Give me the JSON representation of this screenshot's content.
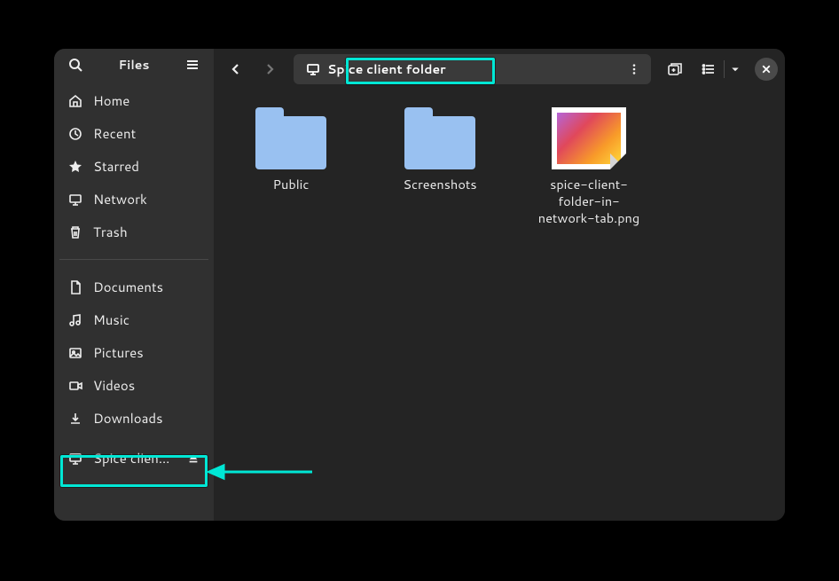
{
  "app_title": "Files",
  "sidebar": {
    "places": [
      {
        "id": "home",
        "label": "Home",
        "icon": "home"
      },
      {
        "id": "recent",
        "label": "Recent",
        "icon": "clock"
      },
      {
        "id": "starred",
        "label": "Starred",
        "icon": "star"
      },
      {
        "id": "network",
        "label": "Network",
        "icon": "network"
      },
      {
        "id": "trash",
        "label": "Trash",
        "icon": "trash"
      }
    ],
    "xdg": [
      {
        "id": "documents",
        "label": "Documents",
        "icon": "document"
      },
      {
        "id": "music",
        "label": "Music",
        "icon": "music"
      },
      {
        "id": "pictures",
        "label": "Pictures",
        "icon": "picture"
      },
      {
        "id": "videos",
        "label": "Videos",
        "icon": "video"
      },
      {
        "id": "downloads",
        "label": "Downloads",
        "icon": "download"
      }
    ],
    "mount": {
      "label": "Spice clien…",
      "full_label": "Spice client folder",
      "icon": "network",
      "ejectable": true
    }
  },
  "path": {
    "segments": [
      {
        "label": "Spice client folder",
        "icon": "network"
      }
    ]
  },
  "files": [
    {
      "name": "Public",
      "type": "folder"
    },
    {
      "name": "Screenshots",
      "type": "folder"
    },
    {
      "name": "spice-client-folder-in-network-tab.png",
      "type": "image"
    }
  ],
  "highlight": {
    "color": "#00e7d5"
  }
}
